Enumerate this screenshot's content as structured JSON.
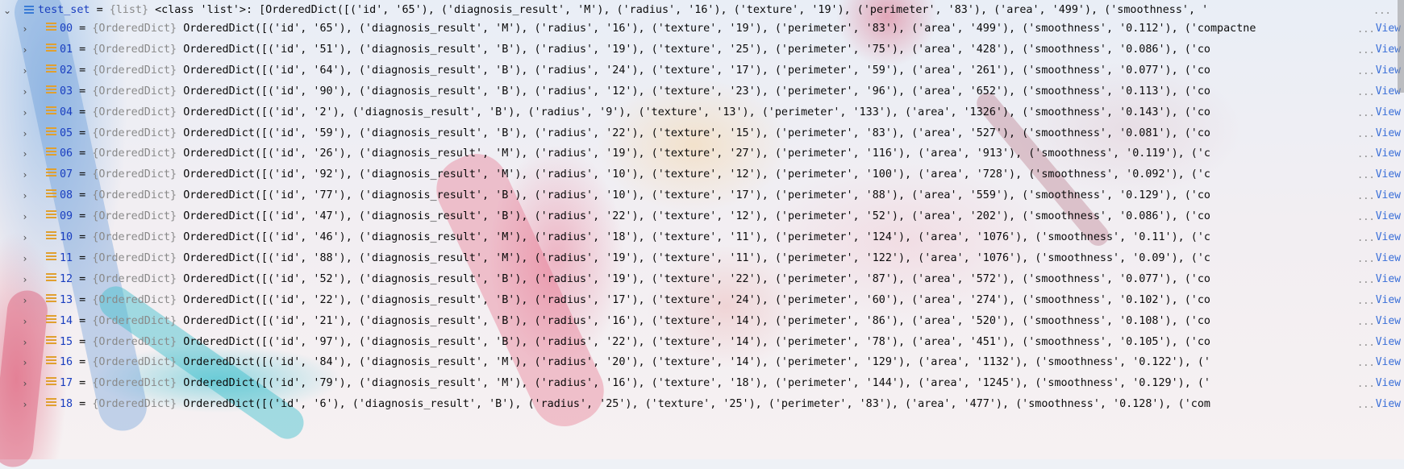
{
  "root": {
    "name": "test_set",
    "type": "{list}",
    "value": "<class 'list'>: [OrderedDict([('id', '65'), ('diagnosis_result', 'M'), ('radius', '16'), ('texture', '19'), ('perimeter', '83'), ('area', '499'), ('smoothness', '"
  },
  "view_label": "View",
  "ellipsis": "...",
  "items": [
    {
      "index": "00",
      "type": "{OrderedDict}",
      "value": "OrderedDict([('id', '65'), ('diagnosis_result', 'M'), ('radius', '16'), ('texture', '19'), ('perimeter', '83'), ('area', '499'), ('smoothness', '0.112'), ('compactne"
    },
    {
      "index": "01",
      "type": "{OrderedDict}",
      "value": "OrderedDict([('id', '51'), ('diagnosis_result', 'B'), ('radius', '19'), ('texture', '25'), ('perimeter', '75'), ('area', '428'), ('smoothness', '0.086'), ('co"
    },
    {
      "index": "02",
      "type": "{OrderedDict}",
      "value": "OrderedDict([('id', '64'), ('diagnosis_result', 'B'), ('radius', '24'), ('texture', '17'), ('perimeter', '59'), ('area', '261'), ('smoothness', '0.077'), ('co"
    },
    {
      "index": "03",
      "type": "{OrderedDict}",
      "value": "OrderedDict([('id', '90'), ('diagnosis_result', 'B'), ('radius', '12'), ('texture', '23'), ('perimeter', '96'), ('area', '652'), ('smoothness', '0.113'), ('co"
    },
    {
      "index": "04",
      "type": "{OrderedDict}",
      "value": "OrderedDict([('id', '2'), ('diagnosis_result', 'B'), ('radius', '9'), ('texture', '13'), ('perimeter', '133'), ('area', '1326'), ('smoothness', '0.143'), ('co"
    },
    {
      "index": "05",
      "type": "{OrderedDict}",
      "value": "OrderedDict([('id', '59'), ('diagnosis_result', 'B'), ('radius', '22'), ('texture', '15'), ('perimeter', '83'), ('area', '527'), ('smoothness', '0.081'), ('co"
    },
    {
      "index": "06",
      "type": "{OrderedDict}",
      "value": "OrderedDict([('id', '26'), ('diagnosis_result', 'M'), ('radius', '19'), ('texture', '27'), ('perimeter', '116'), ('area', '913'), ('smoothness', '0.119'), ('c"
    },
    {
      "index": "07",
      "type": "{OrderedDict}",
      "value": "OrderedDict([('id', '92'), ('diagnosis_result', 'M'), ('radius', '10'), ('texture', '12'), ('perimeter', '100'), ('area', '728'), ('smoothness', '0.092'), ('c"
    },
    {
      "index": "08",
      "type": "{OrderedDict}",
      "value": "OrderedDict([('id', '77'), ('diagnosis_result', 'B'), ('radius', '10'), ('texture', '17'), ('perimeter', '88'), ('area', '559'), ('smoothness', '0.129'), ('co"
    },
    {
      "index": "09",
      "type": "{OrderedDict}",
      "value": "OrderedDict([('id', '47'), ('diagnosis_result', 'B'), ('radius', '22'), ('texture', '12'), ('perimeter', '52'), ('area', '202'), ('smoothness', '0.086'), ('co"
    },
    {
      "index": "10",
      "type": "{OrderedDict}",
      "value": "OrderedDict([('id', '46'), ('diagnosis_result', 'M'), ('radius', '18'), ('texture', '11'), ('perimeter', '124'), ('area', '1076'), ('smoothness', '0.11'), ('c"
    },
    {
      "index": "11",
      "type": "{OrderedDict}",
      "value": "OrderedDict([('id', '88'), ('diagnosis_result', 'M'), ('radius', '19'), ('texture', '11'), ('perimeter', '122'), ('area', '1076'), ('smoothness', '0.09'), ('c"
    },
    {
      "index": "12",
      "type": "{OrderedDict}",
      "value": "OrderedDict([('id', '52'), ('diagnosis_result', 'B'), ('radius', '19'), ('texture', '22'), ('perimeter', '87'), ('area', '572'), ('smoothness', '0.077'), ('co"
    },
    {
      "index": "13",
      "type": "{OrderedDict}",
      "value": "OrderedDict([('id', '22'), ('diagnosis_result', 'B'), ('radius', '17'), ('texture', '24'), ('perimeter', '60'), ('area', '274'), ('smoothness', '0.102'), ('co"
    },
    {
      "index": "14",
      "type": "{OrderedDict}",
      "value": "OrderedDict([('id', '21'), ('diagnosis_result', 'B'), ('radius', '16'), ('texture', '14'), ('perimeter', '86'), ('area', '520'), ('smoothness', '0.108'), ('co"
    },
    {
      "index": "15",
      "type": "{OrderedDict}",
      "value": "OrderedDict([('id', '97'), ('diagnosis_result', 'B'), ('radius', '22'), ('texture', '14'), ('perimeter', '78'), ('area', '451'), ('smoothness', '0.105'), ('co"
    },
    {
      "index": "16",
      "type": "{OrderedDict}",
      "value": "OrderedDict([('id', '84'), ('diagnosis_result', 'M'), ('radius', '20'), ('texture', '14'), ('perimeter', '129'), ('area', '1132'), ('smoothness', '0.122'), ('"
    },
    {
      "index": "17",
      "type": "{OrderedDict}",
      "value": "OrderedDict([('id', '79'), ('diagnosis_result', 'M'), ('radius', '16'), ('texture', '18'), ('perimeter', '144'), ('area', '1245'), ('smoothness', '0.129'), ('"
    },
    {
      "index": "18",
      "type": "{OrderedDict}",
      "value": "OrderedDict([('id', '6'), ('diagnosis_result', 'B'), ('radius', '25'), ('texture', '25'), ('perimeter', '83'), ('area', '477'), ('smoothness', '0.128'), ('com"
    }
  ]
}
